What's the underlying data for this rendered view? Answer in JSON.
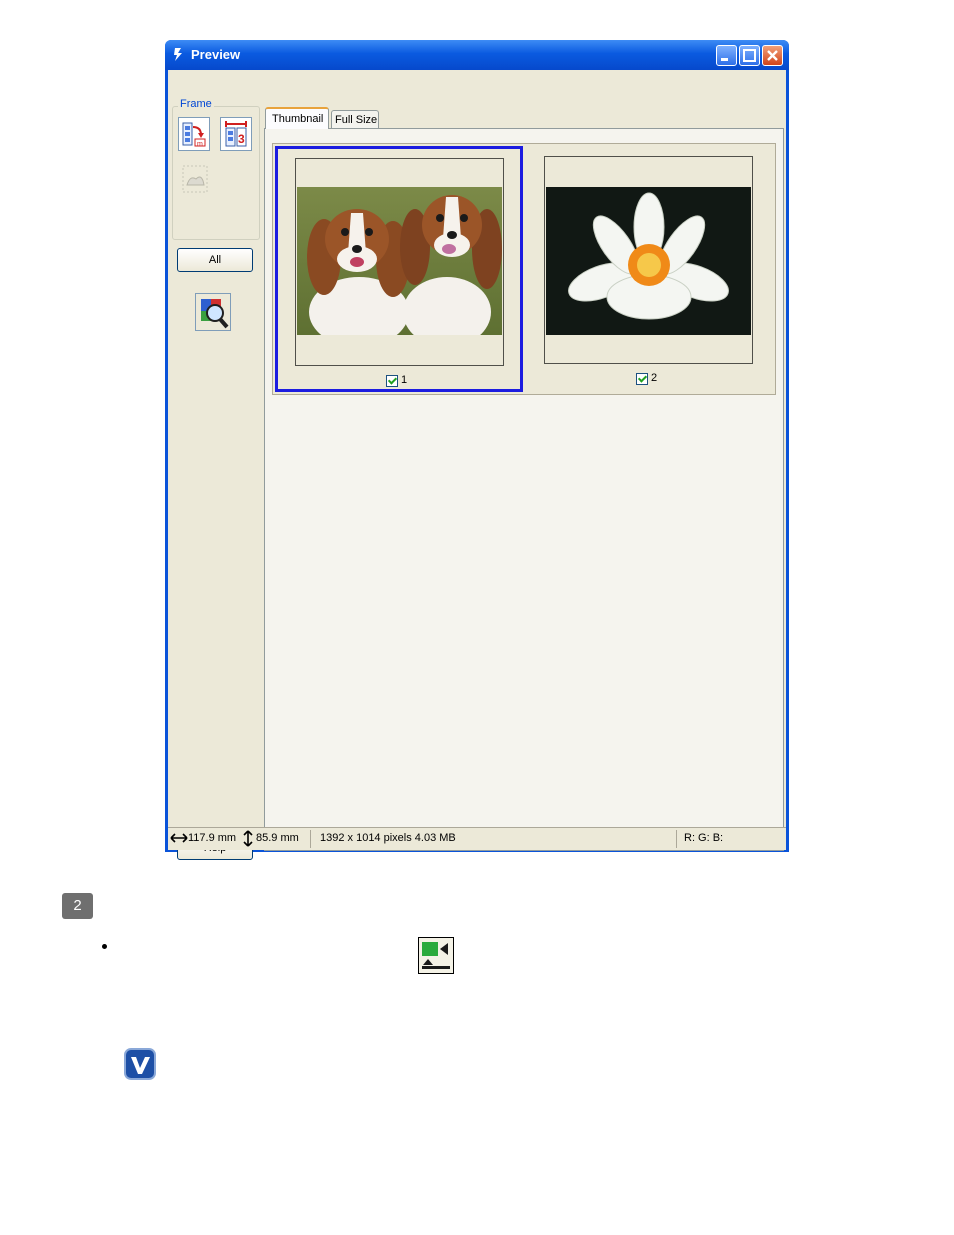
{
  "window": {
    "title": "Preview",
    "title_icon": "scanner-app-icon",
    "buttons": [
      "minimize",
      "maximize",
      "close"
    ]
  },
  "left_panel": {
    "frame_group_label": "Frame",
    "all_button_label": "All",
    "help_button_label": "Help",
    "icons": [
      "frame-auto-locate-icon",
      "frame-selection-icon",
      "frame-disabled-icon",
      "zoom-magnifier-icon"
    ]
  },
  "tabs": [
    {
      "label": "Thumbnail",
      "active": true
    },
    {
      "label": "Full Size",
      "active": false
    }
  ],
  "thumbnails": [
    {
      "number": "1",
      "checked": true,
      "selected": true,
      "image": "two-dogs-photo"
    },
    {
      "number": "2",
      "checked": true,
      "selected": false,
      "image": "white-water-lily-photo"
    }
  ],
  "status": {
    "width": "117.9 mm",
    "height": "85.9 mm",
    "info": "1392 x 1014 pixels 4.03 MB",
    "rgb": "R: G: B:"
  },
  "page": {
    "step_number": "2",
    "inline_icon": "full-size-preview-icon",
    "note_icon": "note-checkmark-icon"
  },
  "colors": {
    "title_bar": "#0a5ae0",
    "selection_border": "#1c1ce0",
    "window_bg": "#ece9d8"
  }
}
